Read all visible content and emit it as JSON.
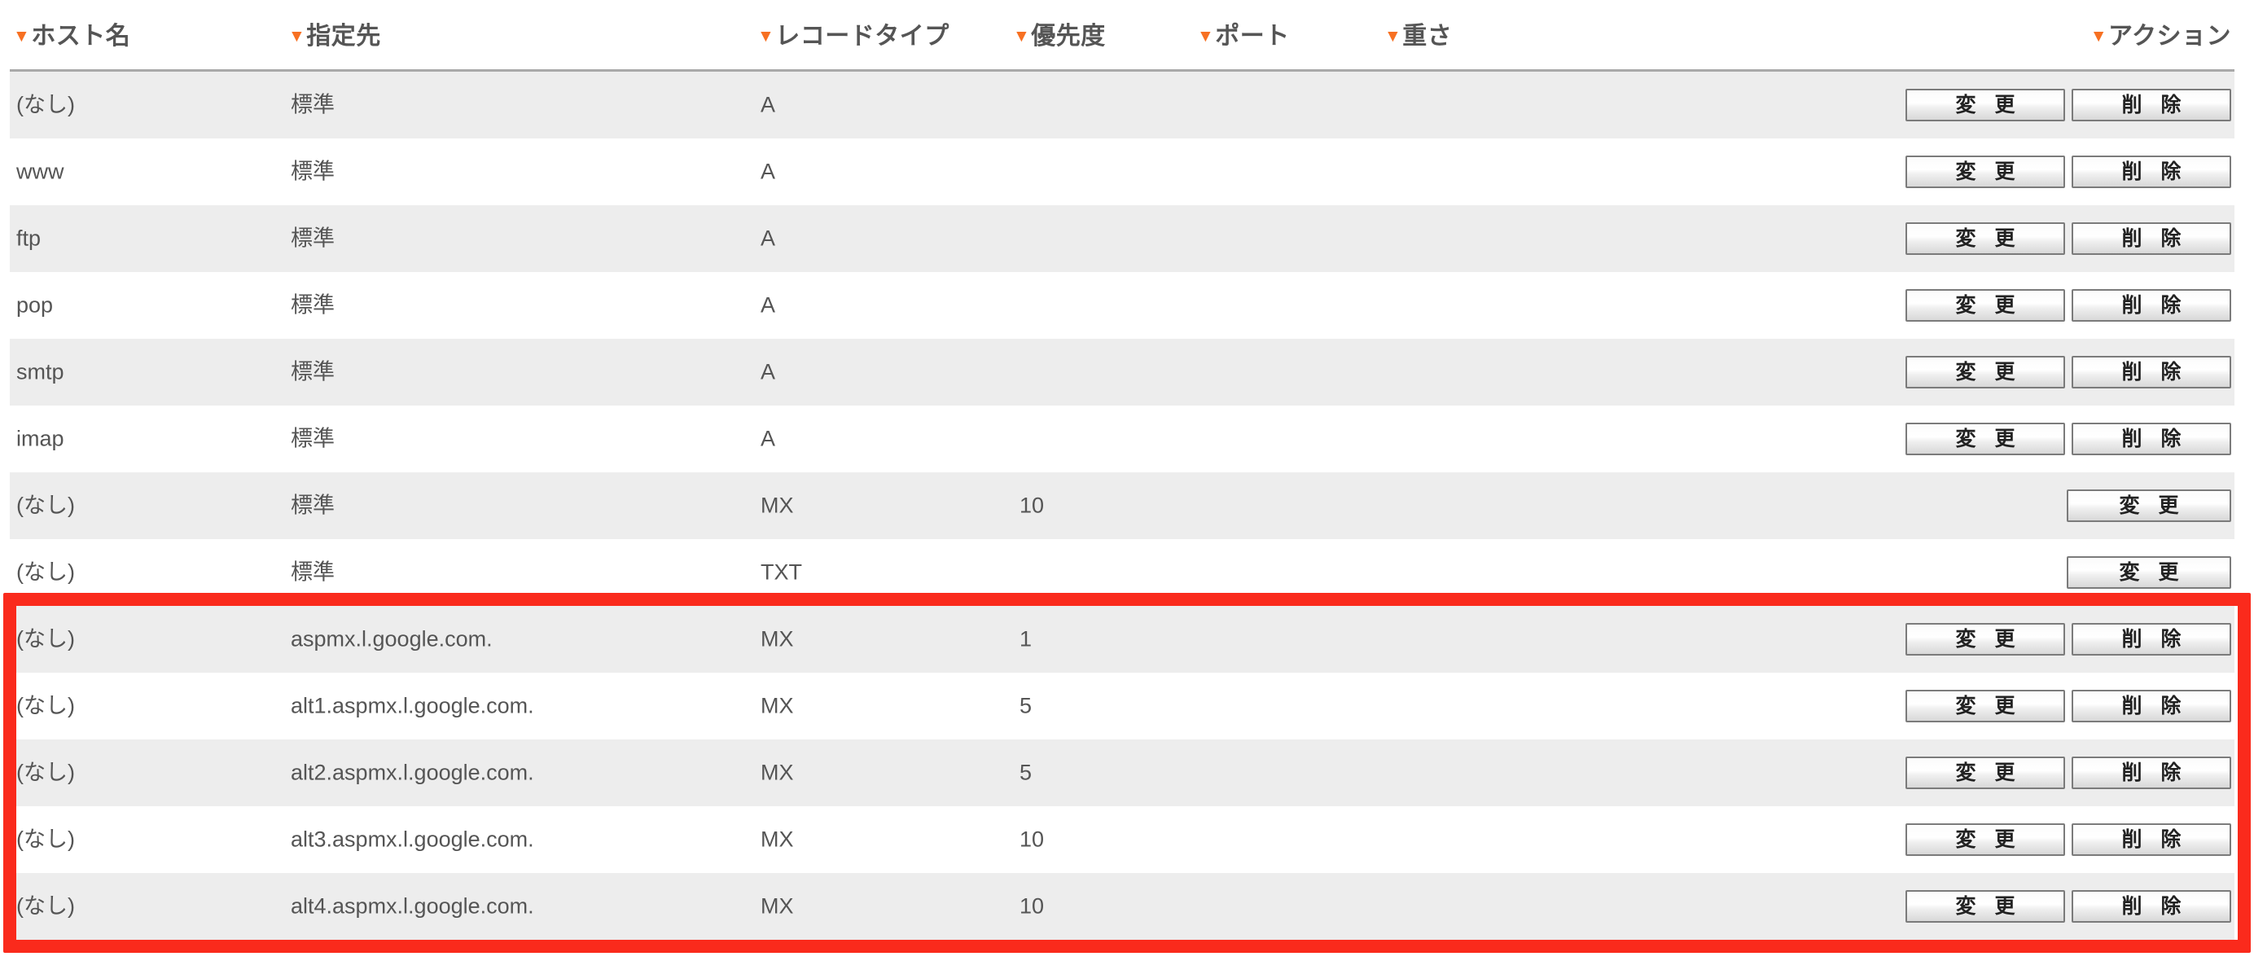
{
  "table": {
    "columns": [
      {
        "key": "host",
        "label": "ホスト名",
        "sort_icon": "sort-triangle-icon"
      },
      {
        "key": "target",
        "label": "指定先",
        "sort_icon": "sort-triangle-icon"
      },
      {
        "key": "type",
        "label": "レコードタイプ",
        "sort_icon": "sort-triangle-icon"
      },
      {
        "key": "prio",
        "label": "優先度",
        "sort_icon": "sort-triangle-icon"
      },
      {
        "key": "port",
        "label": "ポート",
        "sort_icon": "sort-triangle-icon"
      },
      {
        "key": "weight",
        "label": "重さ",
        "sort_icon": "sort-triangle-icon"
      },
      {
        "key": "action",
        "label": "アクション",
        "sort_icon": "sort-triangle-icon"
      }
    ],
    "buttons": {
      "edit_label": "変 更",
      "delete_label": "削 除"
    },
    "rows": [
      {
        "host": "(なし)",
        "target": "標準",
        "type": "A",
        "prio": "",
        "port": "",
        "weight": "",
        "actions": [
          "edit",
          "delete"
        ]
      },
      {
        "host": "www",
        "target": "標準",
        "type": "A",
        "prio": "",
        "port": "",
        "weight": "",
        "actions": [
          "edit",
          "delete"
        ]
      },
      {
        "host": "ftp",
        "target": "標準",
        "type": "A",
        "prio": "",
        "port": "",
        "weight": "",
        "actions": [
          "edit",
          "delete"
        ]
      },
      {
        "host": "pop",
        "target": "標準",
        "type": "A",
        "prio": "",
        "port": "",
        "weight": "",
        "actions": [
          "edit",
          "delete"
        ]
      },
      {
        "host": "smtp",
        "target": "標準",
        "type": "A",
        "prio": "",
        "port": "",
        "weight": "",
        "actions": [
          "edit",
          "delete"
        ]
      },
      {
        "host": "imap",
        "target": "標準",
        "type": "A",
        "prio": "",
        "port": "",
        "weight": "",
        "actions": [
          "edit",
          "delete"
        ]
      },
      {
        "host": "(なし)",
        "target": "標準",
        "type": "MX",
        "prio": "10",
        "port": "",
        "weight": "",
        "actions": [
          "edit"
        ]
      },
      {
        "host": "(なし)",
        "target": "標準",
        "type": "TXT",
        "prio": "",
        "port": "",
        "weight": "",
        "actions": [
          "edit"
        ]
      },
      {
        "host": "(なし)",
        "target": "aspmx.l.google.com.",
        "type": "MX",
        "prio": "1",
        "port": "",
        "weight": "",
        "actions": [
          "edit",
          "delete"
        ]
      },
      {
        "host": "(なし)",
        "target": "alt1.aspmx.l.google.com.",
        "type": "MX",
        "prio": "5",
        "port": "",
        "weight": "",
        "actions": [
          "edit",
          "delete"
        ]
      },
      {
        "host": "(なし)",
        "target": "alt2.aspmx.l.google.com.",
        "type": "MX",
        "prio": "5",
        "port": "",
        "weight": "",
        "actions": [
          "edit",
          "delete"
        ]
      },
      {
        "host": "(なし)",
        "target": "alt3.aspmx.l.google.com.",
        "type": "MX",
        "prio": "10",
        "port": "",
        "weight": "",
        "actions": [
          "edit",
          "delete"
        ]
      },
      {
        "host": "(なし)",
        "target": "alt4.aspmx.l.google.com.",
        "type": "MX",
        "prio": "10",
        "port": "",
        "weight": "",
        "actions": [
          "edit",
          "delete"
        ]
      }
    ]
  },
  "annotation": {
    "highlight_color": "#fa2a1c",
    "highlight_first_row_index": 8,
    "highlight_last_row_index": 12
  },
  "theme": {
    "accent": "#f77022",
    "text": "#555555",
    "row_alt_bg": "#ededed",
    "row_bg": "#ffffff",
    "header_rule": "#a9a9a9"
  }
}
